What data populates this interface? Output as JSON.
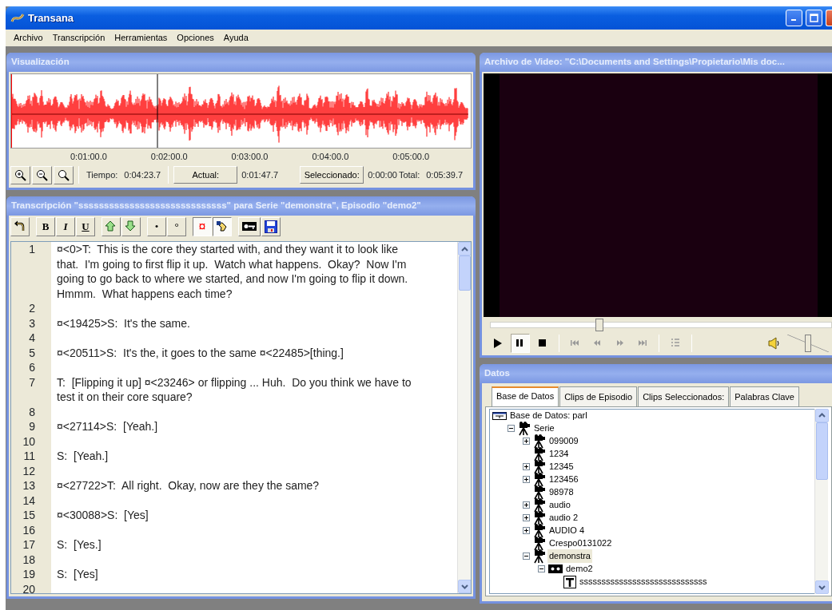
{
  "window": {
    "title": "Transana"
  },
  "menu": [
    "Archivo",
    "Transcripción",
    "Herramientas",
    "Opciones",
    "Ayuda"
  ],
  "visualization": {
    "title": "Visualización",
    "time_axis": [
      "0:01:00.0",
      "0:02:00.0",
      "0:03:00.0",
      "0:04:00.0",
      "0:05:00.0"
    ],
    "zoom_buttons": [
      {
        "kind": "zoom-in"
      },
      {
        "kind": "zoom-out"
      },
      {
        "kind": "zoom-fit"
      }
    ],
    "status": {
      "time_label": "Tiempo:",
      "time": "0:04:23.7",
      "current_button": "Actual:",
      "current": "0:01:47.7",
      "selected_button": "Seleccionado:",
      "selected": "0:00:00",
      "total_label": "Total:",
      "total": "0:05:39.7"
    }
  },
  "transcript": {
    "title": "Transcripción \"sssssssssssssssssssssssssssss\" para Serie \"demonstra\", Episodio \"demo2\"",
    "toolbar": [
      {
        "kind": "undo",
        "pressed": false
      },
      {
        "kind": "bold",
        "label": "B",
        "pressed": false
      },
      {
        "kind": "italic",
        "label": "I",
        "pressed": false
      },
      {
        "kind": "underline",
        "label": "U",
        "pressed": false
      },
      {
        "kind": "rising",
        "pressed": false
      },
      {
        "kind": "falling",
        "pressed": false
      },
      {
        "kind": "dot",
        "label": "•",
        "pressed": false
      },
      {
        "kind": "degree",
        "label": "°",
        "pressed": false
      },
      {
        "kind": "timecode",
        "label": "¤",
        "pressed": true
      },
      {
        "kind": "hand",
        "pressed": true
      },
      {
        "kind": "properties",
        "pressed": false
      },
      {
        "kind": "save",
        "pressed": false
      }
    ],
    "rows": [
      {
        "number": "1",
        "text": "¤<0>T:  This is the core they started with, and they want it to look like that.  I'm going to first flip it up.  Watch what happens.  Okay?  Now I'm going to go back to where we started, and now I'm going to flip it down.  Hmmm.  What happens each time?"
      },
      {
        "number": "2"
      },
      {
        "number": "3",
        "text": "¤<19425>S:  It's the same."
      },
      {
        "number": "4"
      },
      {
        "number": "5",
        "text": "¤<20511>S:  It's the, it goes to the same ¤<22485>[thing.]"
      },
      {
        "number": "6"
      },
      {
        "number": "7",
        "text": "T:  [Flipping it up] ¤<23246> or flipping ... Huh.  Do you think we have to test it on their core square?"
      },
      {
        "number": "8"
      },
      {
        "number": "9",
        "text": "¤<27114>S:  [Yeah.]"
      },
      {
        "number": "10"
      },
      {
        "number": "11",
        "text": "S:  [Yeah.]"
      },
      {
        "number": "12"
      },
      {
        "number": "13",
        "text": "¤<27722>T:  All right.  Okay, now are they the same?"
      },
      {
        "number": "14"
      },
      {
        "number": "15",
        "text": "¤<30088>S:  [Yes]"
      },
      {
        "number": "16"
      },
      {
        "number": "17",
        "text": "S:  [Yes.]"
      },
      {
        "number": "18"
      },
      {
        "number": "19",
        "text": "S:  [Yes]"
      },
      {
        "number": "20"
      }
    ]
  },
  "video": {
    "title": "Archivo de Video: \"C:\\Documents and Settings\\Propietario\\Mis doc...",
    "position": {
      "level": 0.32
    },
    "controls": [
      {
        "kind": "play",
        "pressed": false
      },
      {
        "kind": "pause",
        "pressed": true
      },
      {
        "kind": "stop",
        "pressed": false
      },
      {
        "kind": "skip-start",
        "pressed": false
      },
      {
        "kind": "rewind",
        "pressed": false
      },
      {
        "kind": "fast-forward",
        "pressed": false
      },
      {
        "kind": "skip-end",
        "pressed": false
      },
      {
        "kind": "list",
        "pressed": false
      }
    ],
    "volume": {
      "level": 0.5
    }
  },
  "data": {
    "title": "Datos",
    "tabs": [
      {
        "label": "Base de Datos",
        "selected": true
      },
      {
        "label": "Clips de Episodio",
        "selected": false
      },
      {
        "label": "Clips Seleccionados:",
        "selected": false
      },
      {
        "label": "Palabras Clave",
        "selected": false
      }
    ],
    "tree": [
      {
        "kind": "database",
        "label": "Base de Datos: parl",
        "selected": false,
        "children": [
          {
            "kind": "series",
            "label": "Serie",
            "expanded": true,
            "selected": false,
            "children": [
              {
                "kind": "series",
                "label": "099009",
                "expanded": false,
                "selected": false
              },
              {
                "kind": "series",
                "label": "1234",
                "selected": false
              },
              {
                "kind": "series",
                "label": "12345",
                "expanded": false,
                "selected": false
              },
              {
                "kind": "series",
                "label": "123456",
                "expanded": false,
                "selected": false
              },
              {
                "kind": "series",
                "label": "98978",
                "selected": false
              },
              {
                "kind": "series",
                "label": "audio",
                "expanded": false,
                "selected": false
              },
              {
                "kind": "series",
                "label": "audio 2",
                "expanded": false,
                "selected": false
              },
              {
                "kind": "series",
                "label": "AUDIO 4",
                "expanded": false,
                "selected": false
              },
              {
                "kind": "series",
                "label": "Crespo0131022",
                "selected": false
              },
              {
                "kind": "series",
                "label": "demonstra",
                "expanded": true,
                "selected": true,
                "children": [
                  {
                    "kind": "episode",
                    "label": "demo2",
                    "expanded": true,
                    "selected": false,
                    "children": [
                      {
                        "kind": "transcript",
                        "label": "sssssssssssssssssssssssssssss",
                        "selected": false
                      }
                    ]
                  }
                ]
              }
            ]
          }
        ]
      }
    ]
  }
}
